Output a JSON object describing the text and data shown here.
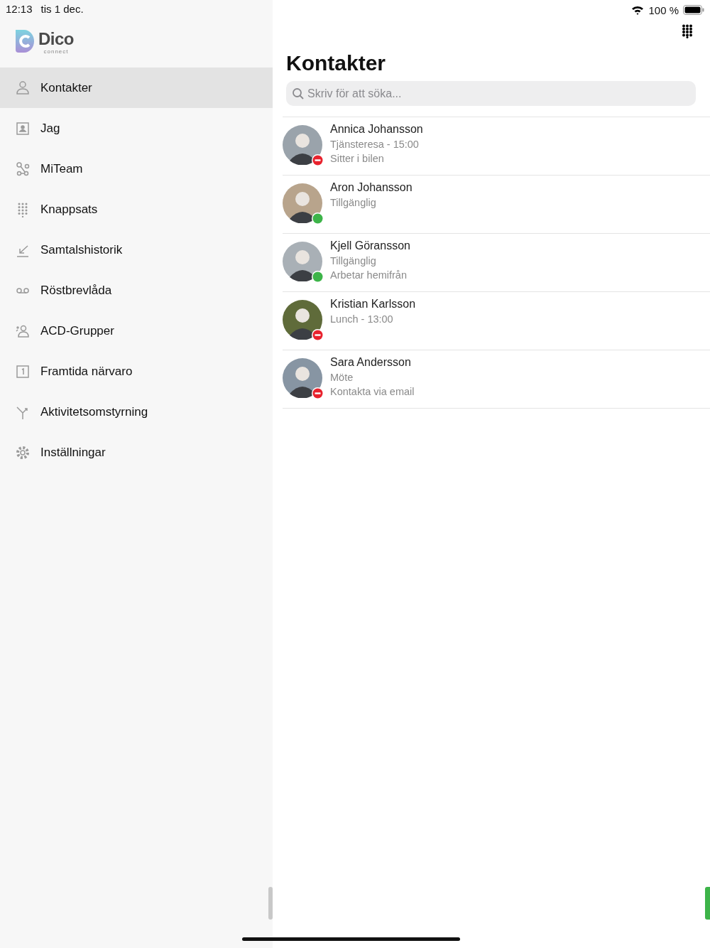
{
  "status_bar": {
    "time": "12:13",
    "date": "tis 1 dec.",
    "battery": "100 %"
  },
  "logo": {
    "name": "Dico",
    "tagline": "connect"
  },
  "sidebar": {
    "items": [
      {
        "label": "Kontakter",
        "selected": true
      },
      {
        "label": "Jag",
        "selected": false
      },
      {
        "label": "MiTeam",
        "selected": false
      },
      {
        "label": "Knappsats",
        "selected": false
      },
      {
        "label": "Samtalshistorik",
        "selected": false
      },
      {
        "label": "Röstbrevlåda",
        "selected": false
      },
      {
        "label": "ACD-Grupper",
        "selected": false
      },
      {
        "label": "Framtida närvaro",
        "selected": false
      },
      {
        "label": "Aktivitetsomstyrning",
        "selected": false
      },
      {
        "label": "Inställningar",
        "selected": false
      }
    ]
  },
  "main": {
    "title": "Kontakter",
    "search": {
      "placeholder": "Skriv för att söka..."
    },
    "contacts": [
      {
        "name": "Annica Johansson",
        "lines": [
          "Tjänsteresa - 15:00",
          "Sitter i bilen"
        ],
        "kind": "busy"
      },
      {
        "name": "Aron Johansson",
        "lines": [
          "Tillgänglig"
        ],
        "kind": "available"
      },
      {
        "name": "Kjell Göransson",
        "lines": [
          "Tillgänglig",
          "Arbetar hemifrån"
        ],
        "kind": "available"
      },
      {
        "name": "Kristian Karlsson",
        "lines": [
          "Lunch - 13:00"
        ],
        "kind": "busy"
      },
      {
        "name": "Sara Andersson",
        "lines": [
          "Möte",
          "Kontakta via email"
        ],
        "kind": "busy"
      }
    ]
  }
}
